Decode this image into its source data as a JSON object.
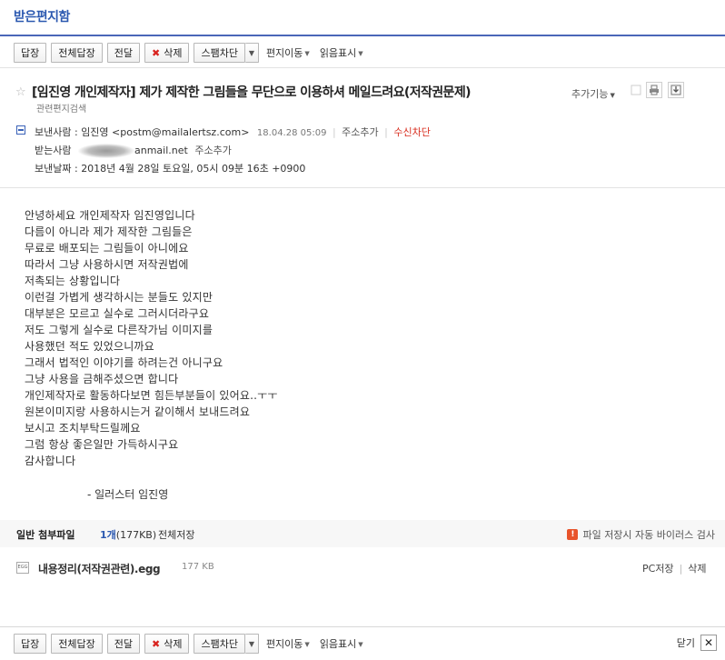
{
  "mailbox": {
    "title": "받은편지함"
  },
  "toolbar": {
    "reply": "답장",
    "reply_all": "전체답장",
    "forward": "전달",
    "delete": "삭제",
    "spam_block": "스팸차단",
    "move": "편지이동",
    "read_mark": "읽음표시",
    "close": "닫기"
  },
  "message": {
    "subject": "[임진영 개인제작자] 제가 제작한 그림들을 무단으로 이용하셔 메일드려요(저작권문제)",
    "related_search": "관련편지검색",
    "extra_functions": "추가기능",
    "sender_label": "보낸사람",
    "sender_value": "임진영 <postm@mailalertsz.com>",
    "sent_time": "18.04.28 05:09",
    "add_address": "주소추가",
    "block_receive": "수신차단",
    "recipient_label": "받는사람",
    "recipient_value": "anmail.net",
    "recipient_add": "주소추가",
    "date_label": "보낸날짜",
    "date_value": "2018년 4월 28일 토요일, 05시 09분 16초 +0900",
    "body_lines": [
      "안녕하세요 개인제작자 임진영입니다",
      "다름이 아니라 제가 제작한 그림들은",
      "무료로 배포되는 그림들이 아니에요",
      "따라서 그냥 사용하시면 저작권법에",
      "저촉되는 상황입니다",
      "이런걸 가볍게 생각하시는 분들도 있지만",
      "대부분은 모르고 실수로 그러시더라구요",
      "저도 그렇게 실수로 다른작가님 이미지를",
      "사용했던 적도 있었으니까요",
      "그래서 법적인 이야기를 하려는건 아니구요",
      "그냥 사용을 금해주셨으면 합니다",
      "개인제작자로 활동하다보면 힘든부분들이 있어요..ㅜㅜ",
      "원본이미지랑 사용하시는거 같이해서 보내드려요",
      "보시고 조치부탁드릴께요",
      "그럼 항상 좋은일만 가득하시구요",
      "감사합니다"
    ],
    "signature": "- 일러스터 임진영"
  },
  "attachments": {
    "section_title": "일반 첨부파일",
    "count": "1개",
    "total_size": "(177KB)",
    "save_all": "전체저장",
    "scan_note": "파일 저장시 자동 바이러스 검사",
    "files": [
      {
        "name": "내용정리(저작권관련).egg",
        "size": "177 KB",
        "save_pc": "PC저장",
        "delete": "삭제"
      }
    ]
  }
}
